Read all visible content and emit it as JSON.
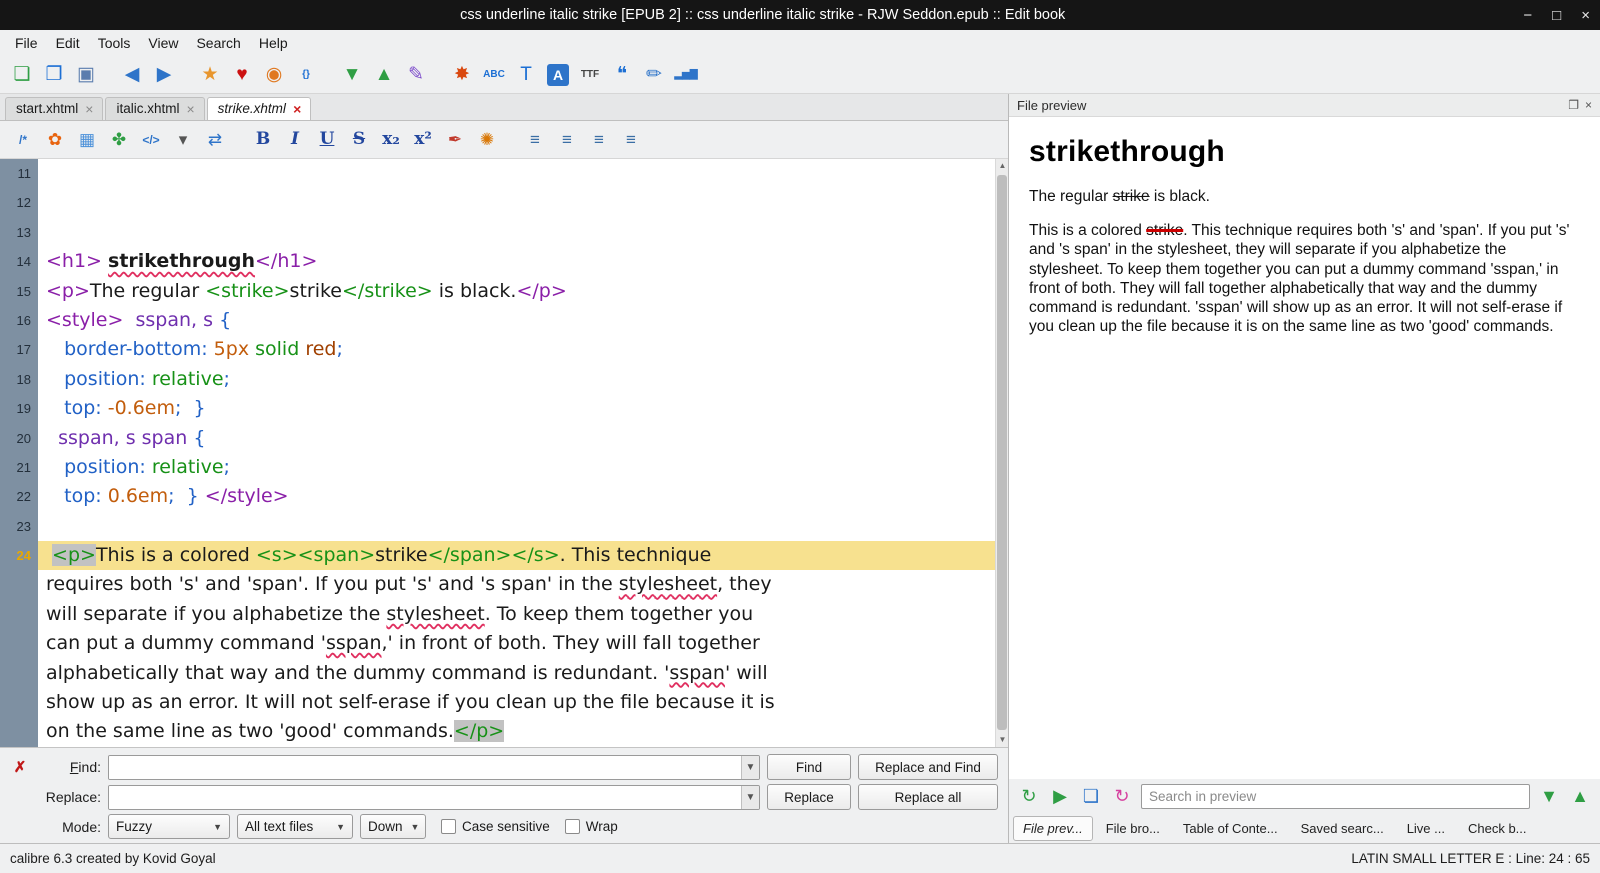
{
  "titlebar": {
    "title": "css underline italic strike [EPUB 2] :: css underline italic strike - RJW Seddon.epub :: Edit book",
    "window_controls": [
      {
        "name": "minimize-icon",
        "glyph": "−"
      },
      {
        "name": "maximize-icon",
        "glyph": "□"
      },
      {
        "name": "close-icon",
        "glyph": "×"
      }
    ]
  },
  "menubar": {
    "items": [
      "File",
      "Edit",
      "Tools",
      "View",
      "Search",
      "Help"
    ]
  },
  "main_toolbar": {
    "icons": [
      {
        "name": "new-file-icon",
        "glyph": "❏",
        "color": "#2f9e44"
      },
      {
        "name": "open-book-icon",
        "glyph": "❐",
        "color": "#1c6fd4"
      },
      {
        "name": "save-icon",
        "glyph": "▣",
        "color": "#5b7dae"
      },
      {
        "name": "sep"
      },
      {
        "name": "back-icon",
        "glyph": "◀",
        "color": "#2e74c9"
      },
      {
        "name": "forward-icon",
        "glyph": "▶",
        "color": "#2e74c9"
      },
      {
        "name": "sep"
      },
      {
        "name": "mark-file-icon",
        "glyph": "★",
        "color": "#e8962e"
      },
      {
        "name": "donate-icon",
        "glyph": "♥",
        "color": "#cc1111"
      },
      {
        "name": "arrange-icon",
        "glyph": "◉",
        "color": "#e07820"
      },
      {
        "name": "insert-tag-icon",
        "glyph": "{}",
        "color": "#1c6fd4",
        "small": true
      },
      {
        "name": "sep"
      },
      {
        "name": "arrow-down-icon",
        "glyph": "▼",
        "color": "#2f9e44"
      },
      {
        "name": "arrow-up-icon",
        "glyph": "▲",
        "color": "#2f9e44"
      },
      {
        "name": "pen-icon",
        "glyph": "✎",
        "color": "#7d4ccb"
      },
      {
        "name": "sep"
      },
      {
        "name": "check-book-icon",
        "glyph": "✸",
        "color": "#d9480f"
      },
      {
        "name": "spellcheck-icon",
        "glyph": "ABC",
        "color": "#1c6fd4",
        "small": true
      },
      {
        "name": "text-search-icon",
        "glyph": "T",
        "color": "#1c6fd4"
      },
      {
        "name": "reports-book-icon",
        "glyph": "A",
        "color": "#ffffff",
        "bg": "#2e74c9"
      },
      {
        "name": "manage-fonts-icon",
        "glyph": "TTF",
        "color": "#444444",
        "small": true
      },
      {
        "name": "smarten-punctuation-icon",
        "glyph": "❝",
        "color": "#1c6fd4"
      },
      {
        "name": "beautify-icon",
        "glyph": "✏",
        "color": "#2e74c9"
      },
      {
        "name": "reports-icon",
        "glyph": "▂▅▇",
        "color": "#2e74c9",
        "small": true
      }
    ]
  },
  "tabs": [
    {
      "label": "start.xhtml",
      "active": false
    },
    {
      "label": "italic.xhtml",
      "active": false
    },
    {
      "label": "strike.xhtml",
      "active": true
    }
  ],
  "editor_toolbar": {
    "icons": [
      {
        "name": "comment-icon",
        "glyph": "/*",
        "color": "#2e74c9",
        "small": true
      },
      {
        "name": "flower-icon",
        "glyph": "✿",
        "color": "#e8640f"
      },
      {
        "name": "insert-image-icon",
        "glyph": "▦",
        "color": "#4a90d9"
      },
      {
        "name": "plant-icon",
        "glyph": "✤",
        "color": "#2f9e44"
      },
      {
        "name": "code-tag-icon",
        "glyph": "</>",
        "color": "#2e74c9",
        "small": true
      },
      {
        "name": "dropdown-arrow-icon",
        "glyph": "▾",
        "color": "#555555",
        "tiny": true
      },
      {
        "name": "swap-icon",
        "glyph": "⇄",
        "color": "#2e74c9"
      },
      {
        "name": "sep"
      },
      {
        "name": "bold-icon",
        "glyph": "B",
        "cls": "fmt",
        "color": "#23479e"
      },
      {
        "name": "italic-icon",
        "glyph": "I",
        "cls": "fmt italic",
        "color": "#23479e"
      },
      {
        "name": "underline-icon",
        "glyph": "U",
        "cls": "fmt underl",
        "color": "#23479e"
      },
      {
        "name": "strikethrough-icon",
        "glyph": "S",
        "cls": "fmt strike",
        "color": "#23479e"
      },
      {
        "name": "subscript-icon",
        "glyph": "x₂",
        "cls": "fmt",
        "color": "#23479e"
      },
      {
        "name": "superscript-icon",
        "glyph": "x²",
        "cls": "fmt",
        "color": "#23479e"
      },
      {
        "name": "brush-icon",
        "glyph": "✒",
        "color": "#c0392b"
      },
      {
        "name": "paint-bucket-icon",
        "glyph": "✺",
        "color": "#d97706"
      },
      {
        "name": "sep"
      },
      {
        "name": "align-left-icon",
        "glyph": "≡",
        "color": "#3a6ea5"
      },
      {
        "name": "align-center-icon",
        "glyph": "≡",
        "color": "#3a6ea5"
      },
      {
        "name": "align-right-icon",
        "glyph": "≡",
        "color": "#3a6ea5"
      },
      {
        "name": "align-justify-icon",
        "glyph": "≡",
        "color": "#3a6ea5"
      }
    ]
  },
  "editor": {
    "rows": [
      {
        "n": "11",
        "t": []
      },
      {
        "n": "12",
        "t": []
      },
      {
        "n": "13",
        "t": []
      },
      {
        "n": "14",
        "t": [
          [
            "tagp",
            "<h1>"
          ],
          [
            "t",
            " "
          ],
          [
            "h1w",
            "strikethrough"
          ],
          [
            "tagp",
            "</h1>"
          ]
        ]
      },
      {
        "n": "15",
        "t": [
          [
            "tagp",
            "<p>"
          ],
          [
            "t",
            "The regular "
          ],
          [
            "tagg",
            "<strike>"
          ],
          [
            "t",
            "strike"
          ],
          [
            "tagg",
            "</strike>"
          ],
          [
            "t",
            " is black."
          ],
          [
            "tagp",
            "</p>"
          ]
        ]
      },
      {
        "n": "16",
        "t": [
          [
            "tagp",
            "<style>"
          ],
          [
            "t",
            "  "
          ],
          [
            "sel",
            "sspan, s"
          ],
          [
            "t",
            " "
          ],
          [
            "punc",
            "{"
          ]
        ]
      },
      {
        "n": "17",
        "t": [
          [
            "t",
            "   "
          ],
          [
            "prop",
            "border-bottom"
          ],
          [
            "punc",
            ":"
          ],
          [
            "t",
            " "
          ],
          [
            "num",
            "5px"
          ],
          [
            "t",
            " "
          ],
          [
            "kw",
            "solid"
          ],
          [
            "t",
            " "
          ],
          [
            "val",
            "red"
          ],
          [
            "punc",
            ";"
          ]
        ]
      },
      {
        "n": "18",
        "t": [
          [
            "t",
            "   "
          ],
          [
            "prop",
            "position"
          ],
          [
            "punc",
            ":"
          ],
          [
            "t",
            " "
          ],
          [
            "kw",
            "relative"
          ],
          [
            "punc",
            ";"
          ]
        ]
      },
      {
        "n": "19",
        "t": [
          [
            "t",
            "   "
          ],
          [
            "prop",
            "top"
          ],
          [
            "punc",
            ":"
          ],
          [
            "t",
            " "
          ],
          [
            "num",
            "-0.6em"
          ],
          [
            "punc",
            ";"
          ],
          [
            "t",
            "  "
          ],
          [
            "punc",
            "}"
          ]
        ]
      },
      {
        "n": "20",
        "t": [
          [
            "t",
            "  "
          ],
          [
            "sel",
            "sspan, s span"
          ],
          [
            "t",
            " "
          ],
          [
            "punc",
            "{"
          ]
        ]
      },
      {
        "n": "21",
        "t": [
          [
            "t",
            "   "
          ],
          [
            "prop",
            "position"
          ],
          [
            "punc",
            ":"
          ],
          [
            "t",
            " "
          ],
          [
            "kw",
            "relative"
          ],
          [
            "punc",
            ";"
          ]
        ]
      },
      {
        "n": "22",
        "t": [
          [
            "t",
            "   "
          ],
          [
            "prop",
            "top"
          ],
          [
            "punc",
            ":"
          ],
          [
            "t",
            " "
          ],
          [
            "num",
            "0.6em"
          ],
          [
            "punc",
            ";"
          ],
          [
            "t",
            "  "
          ],
          [
            "punc",
            "}"
          ],
          [
            "t",
            " "
          ],
          [
            "tagp",
            "</style>"
          ]
        ]
      },
      {
        "n": "23",
        "t": []
      },
      {
        "n": "24",
        "hl": true,
        "t": [
          [
            "t",
            " "
          ],
          [
            "tagm",
            "<p>"
          ],
          [
            "t",
            "This is a colored "
          ],
          [
            "tagg",
            "<s>"
          ],
          [
            "tagg",
            "<span>"
          ],
          [
            "t",
            "strike"
          ],
          [
            "tagg",
            "</span>"
          ],
          [
            "tagg",
            "</s>"
          ],
          [
            "t",
            ". This technique"
          ]
        ]
      },
      {
        "n": "",
        "t": [
          [
            "t",
            "requires both 's' and 'span'. If you put 's' and 's span' in the "
          ],
          [
            "sp",
            "stylesheet"
          ],
          [
            "t",
            ", they"
          ]
        ]
      },
      {
        "n": "",
        "t": [
          [
            "t",
            "will separate if you alphabetize the "
          ],
          [
            "sp",
            "stylesheet"
          ],
          [
            "t",
            ". To keep them together you"
          ]
        ]
      },
      {
        "n": "",
        "t": [
          [
            "t",
            "can put a dummy command '"
          ],
          [
            "sp",
            "sspan"
          ],
          [
            "t",
            ",' in front of both. They will fall together"
          ]
        ]
      },
      {
        "n": "",
        "t": [
          [
            "t",
            "alphabetically that way and the dummy command is redundant. '"
          ],
          [
            "sp",
            "sspan"
          ],
          [
            "t",
            "' will"
          ]
        ]
      },
      {
        "n": "",
        "t": [
          [
            "t",
            "show up as an error. It will not self-erase if you clean up the file because it is"
          ]
        ]
      },
      {
        "n": "",
        "t": [
          [
            "t",
            "on the same line as two 'good' commands."
          ],
          [
            "tagm",
            "</p>"
          ]
        ]
      }
    ]
  },
  "find_panel": {
    "close_glyph": "✗",
    "find_label": "Find:",
    "replace_label": "Replace:",
    "find_value": "",
    "replace_value": "",
    "find_button": "Find",
    "replace_and_find_button": "Replace and Find",
    "replace_button": "Replace",
    "replace_all_button": "Replace all",
    "mode_label": "Mode:",
    "mode_value": "Fuzzy",
    "scope_value": "All text files",
    "direction_value": "Down",
    "case_sensitive_label": "Case sensitive",
    "wrap_label": "Wrap"
  },
  "preview": {
    "header": "File preview",
    "float_glyph": "❐",
    "close_glyph": "×",
    "heading": "strikethrough",
    "para1": {
      "pre": "The regular ",
      "strike": "strike",
      "post": " is black."
    },
    "para2": {
      "pre": "This is a colored ",
      "strike": "strike",
      "post": ". This technique requires both 's' and 'span'. If you put 's' and 's span' in the stylesheet, they will separate if you alphabetize the stylesheet. To keep them together you can put a dummy command 'sspan,' in front of both. They will fall together alphabetically that way and the dummy command is redundant. 'sspan' will show up as an error. It will not self-erase if you clean up the file because it is on the same line as two 'good' commands."
    },
    "controls": [
      {
        "name": "refresh-preview-icon",
        "glyph": "↻",
        "color": "#2f9e44"
      },
      {
        "name": "run-preview-icon",
        "glyph": "▶",
        "color": "#2f9e44"
      },
      {
        "name": "file-icon",
        "glyph": "❏",
        "color": "#2e74c9"
      },
      {
        "name": "reload-icon",
        "glyph": "↻",
        "color": "#d6409f"
      }
    ],
    "search_placeholder": "Search in preview",
    "find_next_glyph": "▼",
    "find_prev_glyph": "▲"
  },
  "panel_tabs": [
    {
      "label": "File prev...",
      "active": true
    },
    {
      "label": "File bro...",
      "active": false
    },
    {
      "label": "Table of Conte...",
      "active": false
    },
    {
      "label": "Saved searc...",
      "active": false
    },
    {
      "label": "Live ...",
      "active": false
    },
    {
      "label": "Check b...",
      "active": false
    }
  ],
  "statusbar": {
    "left": "calibre 6.3 created by Kovid Goyal",
    "right": "LATIN SMALL LETTER E : Line: 24 : 65"
  }
}
